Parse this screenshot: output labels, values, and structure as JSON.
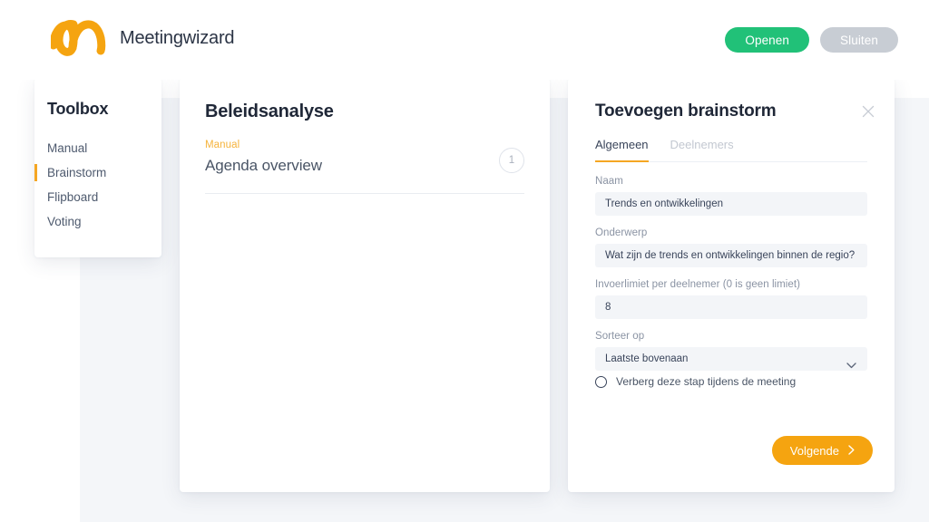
{
  "header": {
    "brand_name": "Meetingwizard",
    "logo_icon": "meetingwizard-logo",
    "open_button": "Openen",
    "close_button": "Sluiten",
    "colors": {
      "open": "#21c178",
      "close": "#c8cdd4",
      "brand_orange": "#f5a410"
    }
  },
  "toolbox": {
    "title": "Toolbox",
    "items": [
      {
        "label": "Manual",
        "active": false
      },
      {
        "label": "Brainstorm",
        "active": true
      },
      {
        "label": "Flipboard",
        "active": false
      },
      {
        "label": "Voting",
        "active": false
      }
    ]
  },
  "agenda": {
    "title": "Beleidsanalyse",
    "rows": [
      {
        "kicker": "Manual",
        "name": "Agenda overview",
        "badge": "1"
      }
    ]
  },
  "dialog": {
    "title": "Toevoegen brainstorm",
    "close_icon": "close-icon",
    "tabs": [
      {
        "label": "Algemeen",
        "active": true
      },
      {
        "label": "Deelnemers",
        "active": false
      }
    ],
    "fields": [
      {
        "label": "Naam",
        "value": "Trends en ontwikkelingen",
        "type": "text"
      },
      {
        "label": "Onderwerp",
        "value": "Wat zijn de trends en ontwikkelingen binnen de regio?",
        "type": "text"
      },
      {
        "label": "Invoerlimiet per deelnemer (0 is geen limiet)",
        "value": "8",
        "type": "number"
      },
      {
        "label": "Sorteer op",
        "value": "Laatste bovenaan",
        "type": "select"
      }
    ],
    "checkbox": {
      "label": "Verberg deze stap tijdens de meeting",
      "checked": false
    },
    "next_button": "Volgende",
    "next_icon": "chevron-right-icon"
  }
}
